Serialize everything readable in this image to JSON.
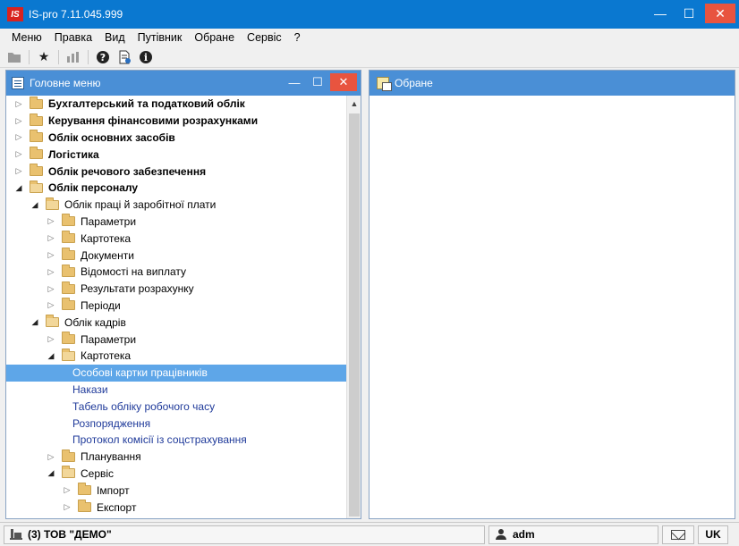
{
  "window": {
    "logo": "IS",
    "title": "IS-pro 7.11.045.999",
    "minimize": "—",
    "maximize": "☐",
    "close": "✕"
  },
  "menubar": [
    "Меню",
    "Правка",
    "Вид",
    "Путівник",
    "Обране",
    "Сервіс",
    "?"
  ],
  "toolbar": {
    "icons": [
      "folder-icon",
      "star-icon",
      "chart-icon",
      "help-icon",
      "document-info-icon",
      "info-icon"
    ],
    "star": "★",
    "help": "❓",
    "info": "ℹ"
  },
  "left_panel": {
    "title": "Головне меню",
    "minimize": "—",
    "maximize": "☐",
    "close": "✕"
  },
  "tree": [
    {
      "label": "Бухгалтерський та податковий облік",
      "level": 0,
      "state": "collapsed",
      "bold": true
    },
    {
      "label": "Керування фінансовими розрахунками",
      "level": 0,
      "state": "collapsed",
      "bold": true
    },
    {
      "label": "Облік основних засобів",
      "level": 0,
      "state": "collapsed",
      "bold": true
    },
    {
      "label": "Логістика",
      "level": 0,
      "state": "collapsed",
      "bold": true
    },
    {
      "label": "Облік речового забезпечення",
      "level": 0,
      "state": "collapsed",
      "bold": true
    },
    {
      "label": "Облік персоналу",
      "level": 0,
      "state": "expanded",
      "bold": true
    },
    {
      "label": "Облік праці й заробітної плати",
      "level": 1,
      "state": "expanded"
    },
    {
      "label": "Параметри",
      "level": 2,
      "state": "collapsed"
    },
    {
      "label": "Картотека",
      "level": 2,
      "state": "collapsed"
    },
    {
      "label": "Документи",
      "level": 2,
      "state": "collapsed"
    },
    {
      "label": "Відомості на виплату",
      "level": 2,
      "state": "collapsed"
    },
    {
      "label": "Результати розрахунку",
      "level": 2,
      "state": "collapsed"
    },
    {
      "label": "Періоди",
      "level": 2,
      "state": "collapsed"
    },
    {
      "label": "Облік кадрів",
      "level": 1,
      "state": "expanded"
    },
    {
      "label": "Параметри",
      "level": 2,
      "state": "collapsed"
    },
    {
      "label": "Картотека",
      "level": 2,
      "state": "expanded"
    },
    {
      "label": "Особові картки працівників",
      "level": 3,
      "state": "leaf",
      "selected": true
    },
    {
      "label": "Накази",
      "level": 3,
      "state": "leaf"
    },
    {
      "label": "Табель обліку робочого часу",
      "level": 3,
      "state": "leaf"
    },
    {
      "label": "Розпорядження",
      "level": 3,
      "state": "leaf"
    },
    {
      "label": "Протокол комісії із соцстрахування",
      "level": 3,
      "state": "leaf"
    },
    {
      "label": "Планування",
      "level": 2,
      "state": "collapsed"
    },
    {
      "label": "Сервіс",
      "level": 2,
      "state": "expanded"
    },
    {
      "label": "Імпорт",
      "level": 3,
      "state": "collapsed"
    },
    {
      "label": "Експорт",
      "level": 3,
      "state": "collapsed"
    }
  ],
  "right_panel": {
    "title": "Обране"
  },
  "status": {
    "company": "(3) ТОВ \"ДЕМО\"",
    "user": "adm",
    "lang": "UK"
  },
  "colors": {
    "titlebar": "#0a78d0",
    "panel_header": "#4a8fd6",
    "selection": "#5ea6e8",
    "close": "#e8543f"
  }
}
